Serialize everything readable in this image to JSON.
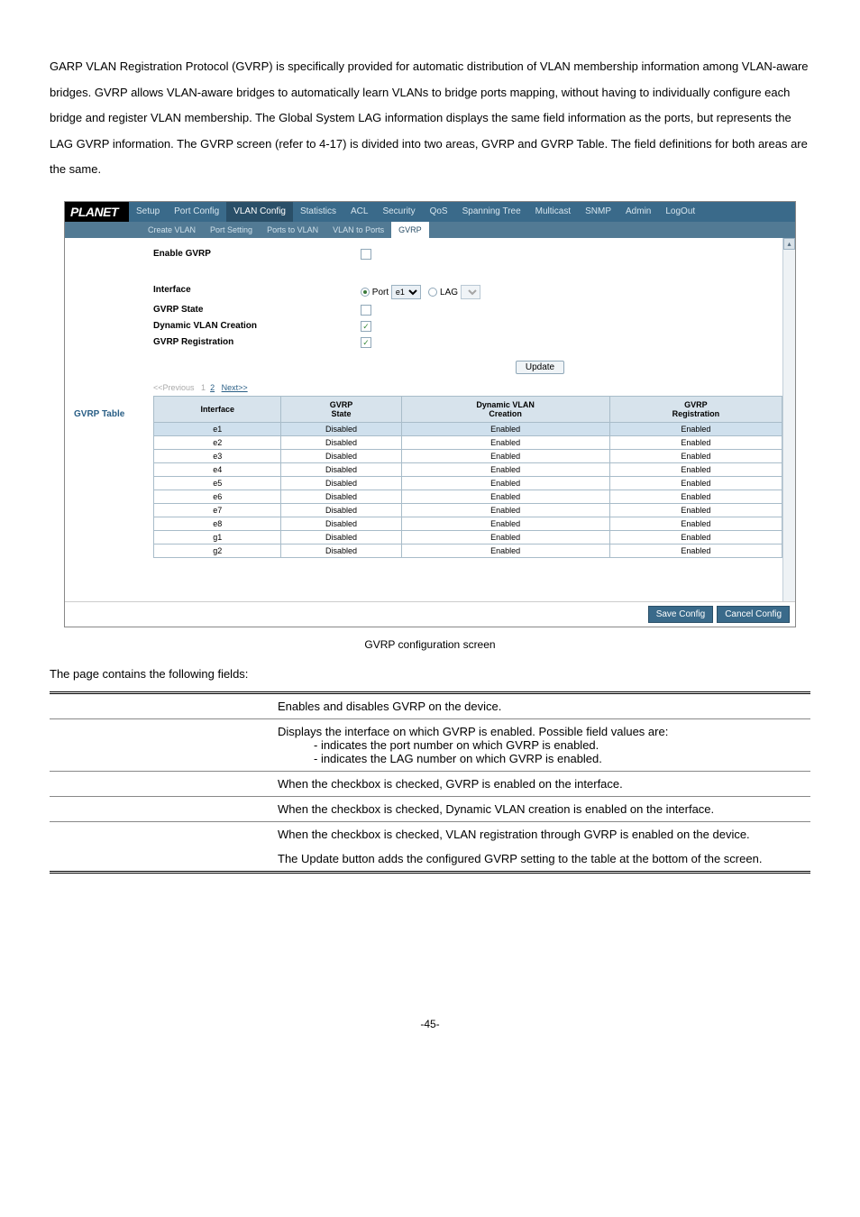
{
  "intro": "GARP VLAN Registration Protocol (GVRP) is specifically provided for automatic distribution of VLAN membership information among VLAN-aware bridges. GVRP allows VLAN-aware bridges to automatically learn VLANs to bridge ports mapping, without having to individually configure each bridge and register VLAN membership. The Global System LAG information displays the same field information as the ports, but represents the LAG GVRP information. The GVRP screen (refer to 4-17) is divided into two areas, GVRP and GVRP Table. The field definitions for both areas are the same.",
  "logo": "PLANET",
  "top_tabs": [
    "Setup",
    "Port Config",
    "VLAN Config",
    "Statistics",
    "ACL",
    "Security",
    "QoS",
    "Spanning Tree",
    "Multicast",
    "SNMP",
    "Admin",
    "LogOut"
  ],
  "active_top": "VLAN Config",
  "sub_tabs": [
    "Create VLAN",
    "Port Setting",
    "Ports to VLAN",
    "VLAN to Ports",
    "GVRP"
  ],
  "active_sub": "GVRP",
  "form": {
    "enable_gvrp": "Enable GVRP",
    "interface": "Interface",
    "gvrp_state": "GVRP State",
    "dyn_vlan": "Dynamic VLAN Creation",
    "gvrp_reg": "GVRP Registration",
    "port": "Port",
    "port_val": "e1",
    "lag": "LAG",
    "update": "Update"
  },
  "sidebar_label": "GVRP Table",
  "pager": {
    "prev": "<<Previous",
    "p1": "1",
    "p2": "2",
    "next": "Next>>"
  },
  "table": {
    "headers": [
      "Interface",
      "GVRP State",
      "Dynamic VLAN Creation",
      "GVRP Registration"
    ],
    "rows": [
      {
        "if": "e1",
        "state": "Disabled",
        "dyn": "Enabled",
        "reg": "Enabled",
        "sel": true
      },
      {
        "if": "e2",
        "state": "Disabled",
        "dyn": "Enabled",
        "reg": "Enabled"
      },
      {
        "if": "e3",
        "state": "Disabled",
        "dyn": "Enabled",
        "reg": "Enabled"
      },
      {
        "if": "e4",
        "state": "Disabled",
        "dyn": "Enabled",
        "reg": "Enabled"
      },
      {
        "if": "e5",
        "state": "Disabled",
        "dyn": "Enabled",
        "reg": "Enabled"
      },
      {
        "if": "e6",
        "state": "Disabled",
        "dyn": "Enabled",
        "reg": "Enabled"
      },
      {
        "if": "e7",
        "state": "Disabled",
        "dyn": "Enabled",
        "reg": "Enabled"
      },
      {
        "if": "e8",
        "state": "Disabled",
        "dyn": "Enabled",
        "reg": "Enabled"
      },
      {
        "if": "g1",
        "state": "Disabled",
        "dyn": "Enabled",
        "reg": "Enabled"
      },
      {
        "if": "g2",
        "state": "Disabled",
        "dyn": "Enabled",
        "reg": "Enabled"
      }
    ]
  },
  "footer": {
    "save": "Save Config",
    "cancel": "Cancel Config"
  },
  "caption": "GVRP configuration screen",
  "fields_intro": "The page contains the following fields:",
  "fields": {
    "r1": "Enables and disables GVRP on the device.",
    "r2a": "Displays the interface on which GVRP is enabled. Possible field values are:",
    "r2b": "- indicates the port number on which GVRP is enabled.",
    "r2c": "- indicates the LAG number on which GVRP is enabled.",
    "r3": "When the checkbox is checked, GVRP is enabled on the interface.",
    "r4": "When the checkbox is checked, Dynamic VLAN creation is enabled on the interface.",
    "r5": "When the checkbox is checked, VLAN registration through GVRP is enabled on the device.",
    "r6": "The Update button adds the configured GVRP setting to the table at the bottom of the screen."
  },
  "page_num": "-45-"
}
